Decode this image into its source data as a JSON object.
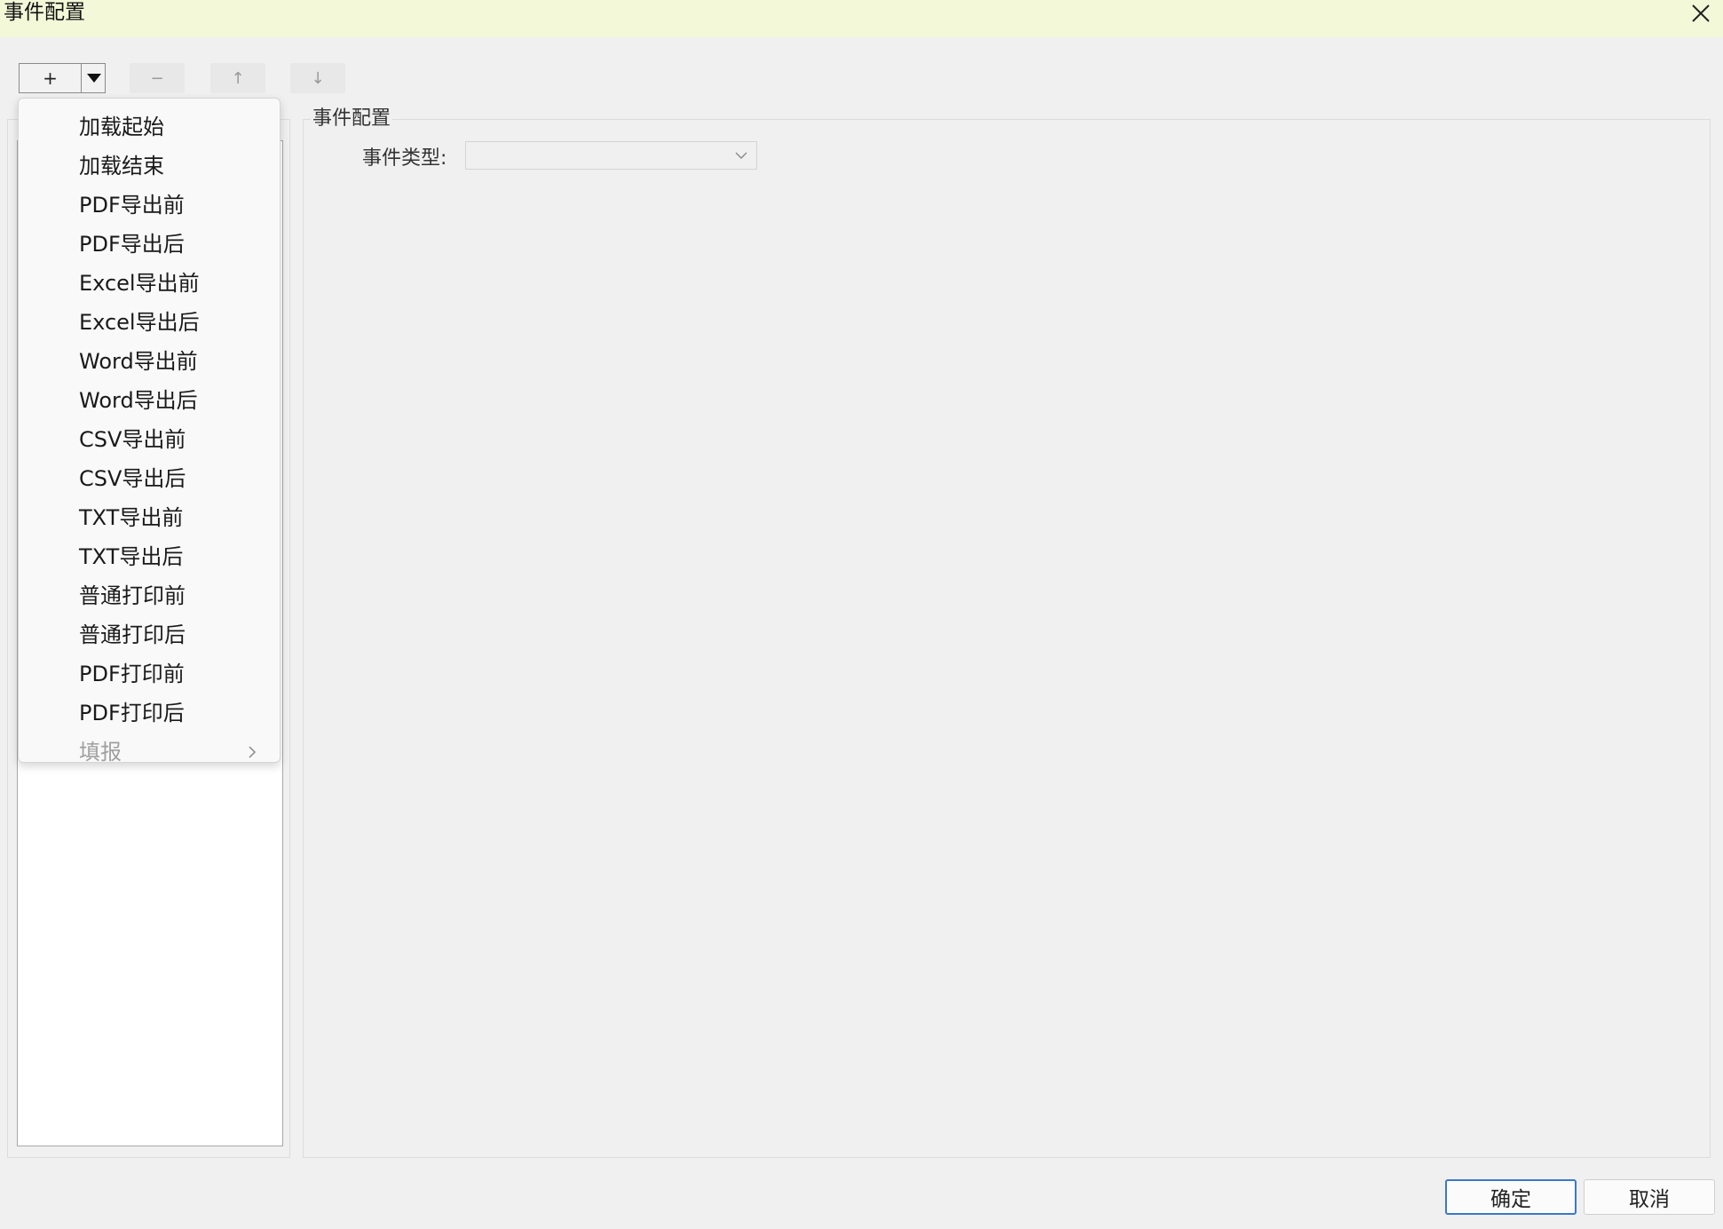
{
  "window": {
    "title": "事件配置"
  },
  "toolbar": {
    "add_label": "+",
    "remove_label": "−",
    "up_label": "↑",
    "down_label": "↓"
  },
  "right_panel": {
    "legend": "事件配置",
    "event_type_label": "事件类型:",
    "event_type_value": ""
  },
  "dropdown_menu": {
    "items": [
      {
        "label": "加载起始",
        "enabled": true
      },
      {
        "label": "加载结束",
        "enabled": true
      },
      {
        "label": "PDF导出前",
        "enabled": true
      },
      {
        "label": "PDF导出后",
        "enabled": true
      },
      {
        "label": "Excel导出前",
        "enabled": true
      },
      {
        "label": "Excel导出后",
        "enabled": true
      },
      {
        "label": "Word导出前",
        "enabled": true
      },
      {
        "label": "Word导出后",
        "enabled": true
      },
      {
        "label": "CSV导出前",
        "enabled": true
      },
      {
        "label": "CSV导出后",
        "enabled": true
      },
      {
        "label": "TXT导出前",
        "enabled": true
      },
      {
        "label": "TXT导出后",
        "enabled": true
      },
      {
        "label": "普通打印前",
        "enabled": true
      },
      {
        "label": "普通打印后",
        "enabled": true
      },
      {
        "label": "PDF打印前",
        "enabled": true
      },
      {
        "label": "PDF打印后",
        "enabled": true
      },
      {
        "label": "填报",
        "enabled": false,
        "has_submenu": true
      }
    ]
  },
  "footer": {
    "ok_label": "确定",
    "cancel_label": "取消"
  },
  "colors": {
    "titlebar_bg": "#f3f8d8",
    "primary_border": "#3a78c9",
    "disabled_text": "#a0a0a0"
  }
}
